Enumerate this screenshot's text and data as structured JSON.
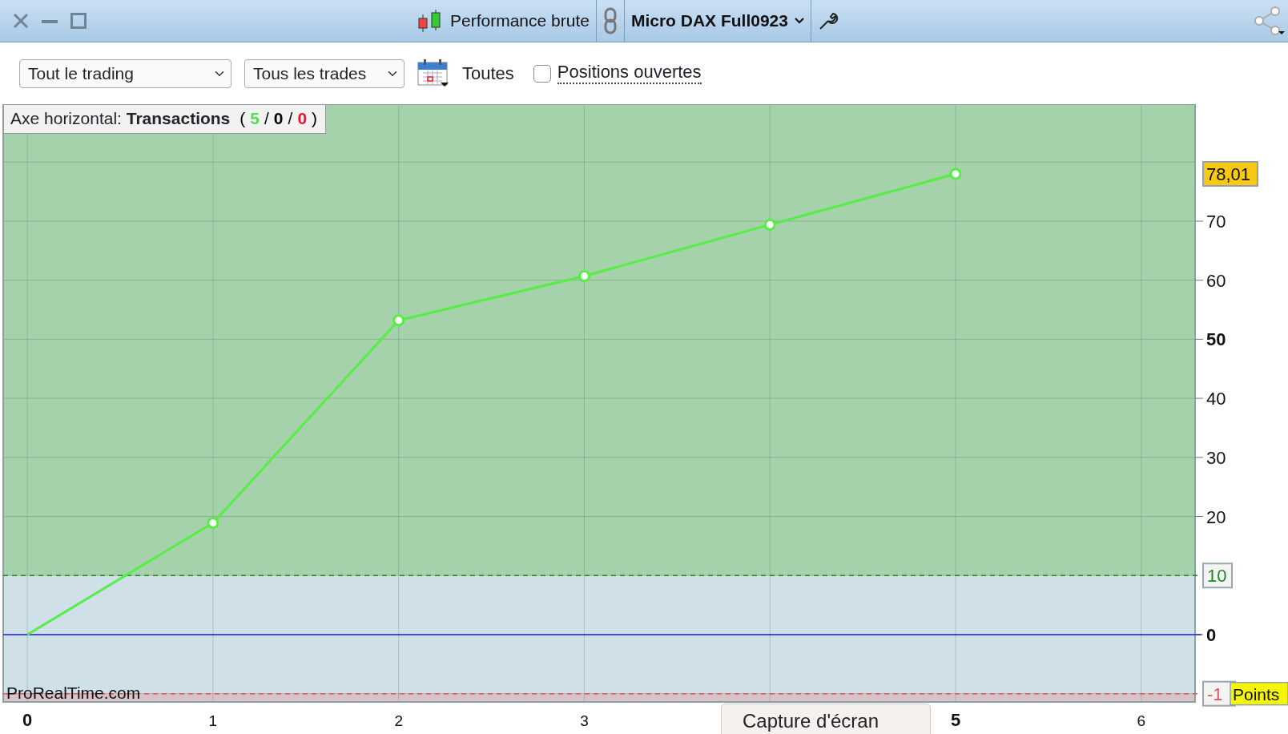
{
  "window": {
    "title": "Performance brute",
    "instrument": "Micro DAX Full0923"
  },
  "toolbar": {
    "period_select": "Tout le trading",
    "trades_select": "Tous les trades",
    "date_label": "Toutes",
    "open_positions": {
      "label": "Positions ouvertes",
      "checked": false
    }
  },
  "axis_info": {
    "label": "Axe horizontal:",
    "axis": "Transactions",
    "counts": [
      {
        "text": "(",
        "color": "#000000"
      },
      {
        "text": "5",
        "color": "#55dd55"
      },
      {
        "text": "/",
        "color": "#000000"
      },
      {
        "text": "0",
        "color": "#000000"
      },
      {
        "text": "/",
        "color": "#000000"
      },
      {
        "text": "0",
        "color": "#ee1133"
      },
      {
        "text": ")",
        "color": "#000000"
      }
    ]
  },
  "chart_data": {
    "type": "line",
    "x": [
      0,
      1,
      2,
      3,
      4,
      5
    ],
    "series": [
      {
        "color": "#55ee44",
        "marker": "o",
        "values": [
          0,
          18.9,
          53.2,
          60.7,
          69.4,
          78
        ]
      }
    ],
    "xlim": [
      -0.13,
      6.29
    ],
    "ylim": [
      -11.4,
      89.8
    ],
    "xticks": [
      0,
      1,
      2,
      3,
      5,
      6
    ],
    "yticks": [
      0,
      20,
      30,
      40,
      50,
      60,
      70
    ],
    "grid": true,
    "ref_lines": [
      {
        "axis": "y",
        "value": 0,
        "color": "#2222dd"
      },
      {
        "axis": "y",
        "value": 10,
        "color": "#228822",
        "label": "10"
      },
      {
        "axis": "y",
        "value": -10,
        "color": "#e05555"
      }
    ],
    "bands": [
      {
        "axis": "y",
        "from": 10,
        "to": 89.8,
        "color": "#a5d2ab"
      },
      {
        "axis": "y",
        "from": -11.4,
        "to": -10,
        "color": "#d9c2c8"
      }
    ]
  },
  "lower_limit_tag": "-1",
  "last_value_tag": "78,01",
  "unit_label": "Points",
  "source_label": "ProRealTime.com",
  "tooltip": "Capture d'écran"
}
